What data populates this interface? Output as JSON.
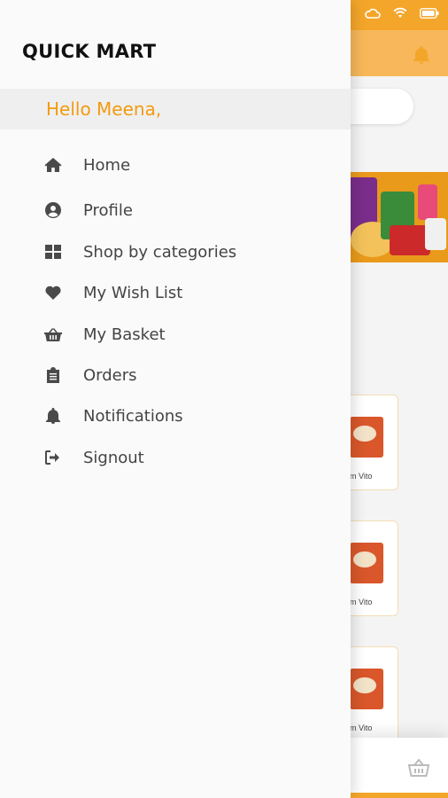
{
  "app": {
    "brand": "QUICK MART"
  },
  "drawer": {
    "greeting": "Hello Meena,",
    "items": [
      {
        "label": "Home",
        "icon": "home-icon"
      },
      {
        "label": "Profile",
        "icon": "user-circle-icon"
      },
      {
        "label": "Shop by categories",
        "icon": "grid-icon"
      },
      {
        "label": "My Wish List",
        "icon": "heart-icon"
      },
      {
        "label": "My Basket",
        "icon": "basket-icon"
      },
      {
        "label": "Orders",
        "icon": "clipboard-icon"
      },
      {
        "label": "Notifications",
        "icon": "bell-icon"
      },
      {
        "label": "Signout",
        "icon": "signout-icon"
      }
    ]
  },
  "background": {
    "product_label_suffix": "m Vito",
    "colors": {
      "accent": "#f4a62a",
      "greeting": "#f39a0e"
    }
  }
}
